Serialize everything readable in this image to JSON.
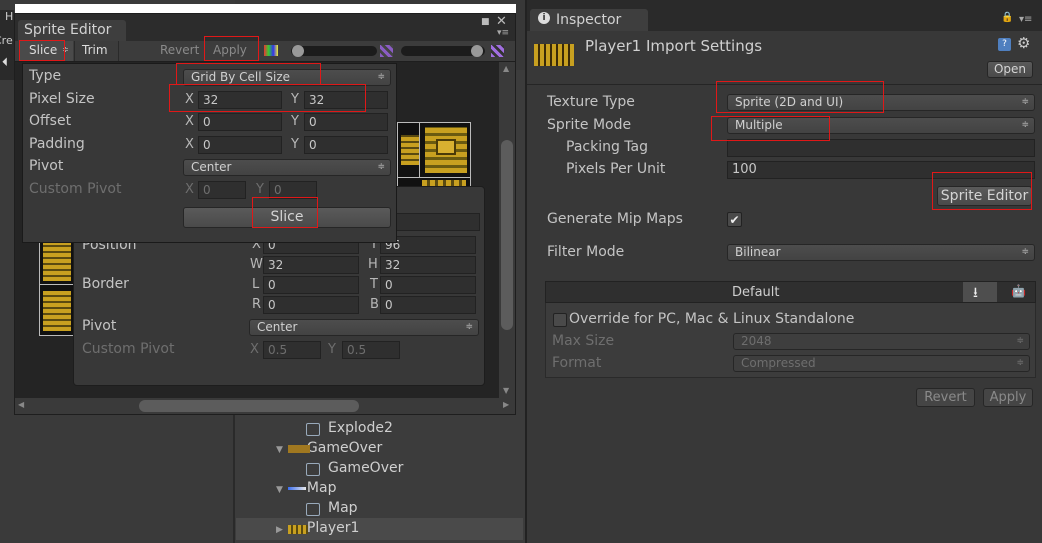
{
  "left_window": {
    "partial_labels": [
      "H",
      "Cre"
    ]
  },
  "sprite_editor": {
    "tab_title": "Sprite Editor",
    "toolbar": {
      "slice": "Slice",
      "trim": "Trim",
      "revert": "Revert",
      "apply": "Apply"
    },
    "slice_panel": {
      "type_label": "Type",
      "type_value": "Grid By Cell Size",
      "pixel_size_label": "Pixel Size",
      "pixel_x": "32",
      "pixel_y": "32",
      "offset_label": "Offset",
      "offset_x": "0",
      "offset_y": "0",
      "padding_label": "Padding",
      "padding_x": "0",
      "padding_y": "0",
      "pivot_label": "Pivot",
      "pivot_value": "Center",
      "custom_pivot_label": "Custom Pivot",
      "custom_pivot_x": "0",
      "custom_pivot_y": "0",
      "slice_button": "Slice",
      "x": "X",
      "y": "Y"
    },
    "sprite_panel": {
      "position_label": "Position",
      "pos_x": "0",
      "pos_y": "96",
      "pos_w": "32",
      "pos_h": "32",
      "border_label": "Border",
      "l": "0",
      "t": "0",
      "r": "0",
      "b": "0",
      "pivot_label": "Pivot",
      "pivot_value": "Center",
      "custom_pivot_label": "Custom Pivot",
      "cp_x": "0.5",
      "cp_y": "0.5",
      "x": "X",
      "y": "Y",
      "w": "W",
      "h": "H",
      "L": "L",
      "T": "T",
      "R": "R",
      "B": "B"
    }
  },
  "hierarchy": {
    "items": [
      {
        "label": "Explode2",
        "indent": 2,
        "arrow": ""
      },
      {
        "label": "GameOver",
        "indent": 1,
        "arrow": "▼"
      },
      {
        "label": "GameOver",
        "indent": 2,
        "arrow": ""
      },
      {
        "label": "Map",
        "indent": 1,
        "arrow": "▼"
      },
      {
        "label": "Map",
        "indent": 2,
        "arrow": ""
      },
      {
        "label": "Player1",
        "indent": 1,
        "arrow": "▶"
      }
    ]
  },
  "inspector": {
    "tab_title": "Inspector",
    "header_title": "Player1 Import Settings",
    "open_button": "Open",
    "texture_type_label": "Texture Type",
    "texture_type_value": "Sprite (2D and UI)",
    "sprite_mode_label": "Sprite Mode",
    "sprite_mode_value": "Multiple",
    "packing_tag_label": "Packing Tag",
    "packing_tag_value": "",
    "ppu_label": "Pixels Per Unit",
    "ppu_value": "100",
    "sprite_editor_button": "Sprite Editor",
    "mip_label": "Generate Mip Maps",
    "mip_checked": "✔",
    "filter_label": "Filter Mode",
    "filter_value": "Bilinear",
    "platform_default": "Default",
    "override_label": "Override for PC, Mac & Linux Standalone",
    "max_size_label": "Max Size",
    "max_size_value": "2048",
    "format_label": "Format",
    "format_value": "Compressed",
    "revert_button": "Revert",
    "apply_button": "Apply"
  },
  "colors": {
    "highlight": "#e01818",
    "background": "#383838",
    "sprite_gold": "#c8a020"
  }
}
